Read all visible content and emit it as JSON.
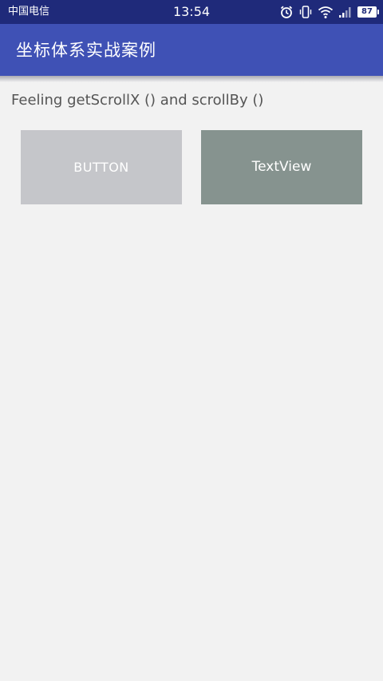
{
  "status_bar": {
    "carrier": "中国电信",
    "time": "13:54",
    "battery": "87",
    "icons": [
      "alarm-icon",
      "vibrate-icon",
      "wifi-icon",
      "signal-icon",
      "battery-icon"
    ]
  },
  "app_bar": {
    "title": "坐标体系实战案例",
    "color": "#3f51b5"
  },
  "content": {
    "description": "Feeling getScrollX () and scrollBy ()",
    "button_label": "BUTTON",
    "textview_label": "TextView"
  },
  "colors": {
    "status_bar": "#1f2a7a",
    "button_bg": "#c5c6ca",
    "textview_bg": "#86938f",
    "background": "#f2f2f2"
  }
}
